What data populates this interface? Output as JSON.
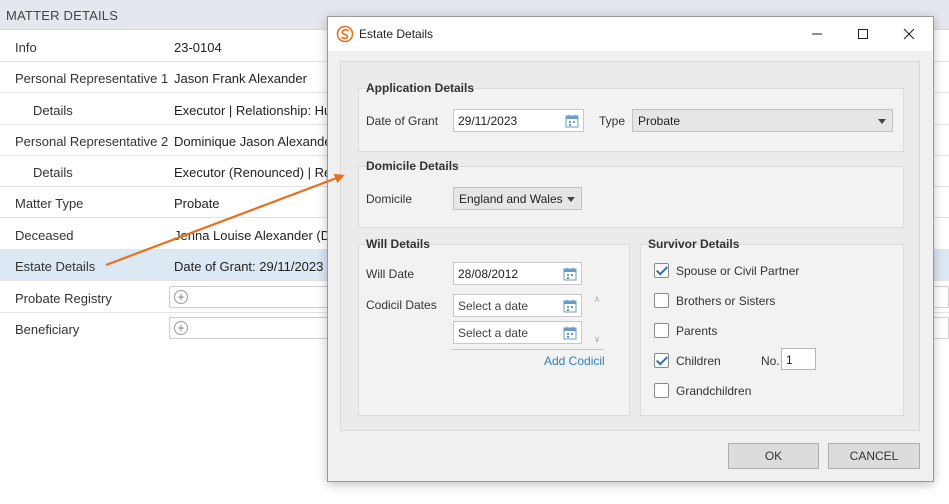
{
  "matter": {
    "header": "MATTER DETAILS",
    "rows": [
      {
        "label": "Info",
        "value": "23-0104"
      },
      {
        "label": "Personal Representative 1",
        "value": "Jason Frank Alexander"
      },
      {
        "label": "Details",
        "value": "Executor | Relationship: Hus"
      },
      {
        "label": "Personal Representative 2",
        "value": "Dominique Jason Alexande"
      },
      {
        "label": "Details",
        "value": "Executor (Renounced) | Rel"
      },
      {
        "label": "Matter Type",
        "value": "Probate"
      },
      {
        "label": "Deceased",
        "value": "Jenna Louise Alexander (Da"
      },
      {
        "label": "Estate Details",
        "value": "Date of Grant: 29/11/2023"
      },
      {
        "label": "Probate Registry",
        "value": ""
      },
      {
        "label": "Beneficiary",
        "value": ""
      }
    ]
  },
  "dialog": {
    "title": "Estate Details",
    "application": {
      "title": "Application Details",
      "date_label": "Date of Grant",
      "date_value": "29/11/2023",
      "type_label": "Type",
      "type_value": "Probate"
    },
    "domicile": {
      "title": "Domicile Details",
      "label": "Domicile",
      "value": "England and Wales"
    },
    "will": {
      "title": "Will Details",
      "date_label": "Will Date",
      "date_value": "28/08/2012",
      "codicil_label": "Codicil Dates",
      "codicil_placeholder_1": "Select a date",
      "codicil_placeholder_2": "Select a date",
      "add_codicil": "Add Codicil"
    },
    "survivor": {
      "title": "Survivor Details",
      "options": [
        {
          "label": "Spouse or Civil Partner",
          "checked": true
        },
        {
          "label": "Brothers or Sisters",
          "checked": false
        },
        {
          "label": "Parents",
          "checked": false
        },
        {
          "label": "Children",
          "checked": true
        },
        {
          "label": "Grandchildren",
          "checked": false
        }
      ],
      "children_no_label": "No.",
      "children_no_value": "1"
    },
    "ok_label": "OK",
    "cancel_label": "CANCEL"
  },
  "colors": {
    "accent": "#2f7fc1",
    "arrow": "#e8701e",
    "selected_row": "#dce8f4"
  }
}
